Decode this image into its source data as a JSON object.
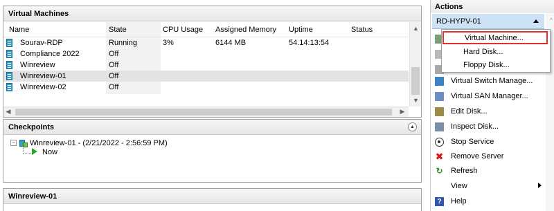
{
  "vm_panel": {
    "title": "Virtual Machines",
    "columns": [
      "Name",
      "State",
      "CPU Usage",
      "Assigned Memory",
      "Uptime",
      "Status"
    ],
    "rows": [
      {
        "name": "Sourav-RDP",
        "state": "Running",
        "cpu": "3%",
        "memory": "6144 MB",
        "uptime": "54.14:13:54",
        "status": ""
      },
      {
        "name": "Compliance 2022",
        "state": "Off",
        "cpu": "",
        "memory": "",
        "uptime": "",
        "status": ""
      },
      {
        "name": "Winreview",
        "state": "Off",
        "cpu": "",
        "memory": "",
        "uptime": "",
        "status": ""
      },
      {
        "name": "Winreview-01",
        "state": "Off",
        "cpu": "",
        "memory": "",
        "uptime": "",
        "status": ""
      },
      {
        "name": "Winreview-02",
        "state": "Off",
        "cpu": "",
        "memory": "",
        "uptime": "",
        "status": ""
      }
    ]
  },
  "checkpoints": {
    "title": "Checkpoints",
    "root": "Winreview-01 - (2/21/2022 - 2:56:59 PM)",
    "child": "Now"
  },
  "details": {
    "title": "Winreview-01"
  },
  "actions": {
    "title": "Actions",
    "server": "RD-HYPV-01",
    "new_submenu": [
      "Virtual Machine...",
      "Hard Disk...",
      "Floppy Disk..."
    ],
    "items": [
      {
        "label": "Virtual Switch Manage...",
        "icon": "network-switch-icon"
      },
      {
        "label": "Virtual SAN Manager...",
        "icon": "san-icon"
      },
      {
        "label": "Edit Disk...",
        "icon": "edit-disk-icon"
      },
      {
        "label": "Inspect Disk...",
        "icon": "inspect-disk-icon"
      },
      {
        "label": "Stop Service",
        "icon": "stop-icon"
      },
      {
        "label": "Remove Server",
        "icon": "remove-icon"
      },
      {
        "label": "Refresh",
        "icon": "refresh-icon"
      },
      {
        "label": "View",
        "icon": ""
      },
      {
        "label": "Help",
        "icon": "help-icon"
      }
    ]
  }
}
